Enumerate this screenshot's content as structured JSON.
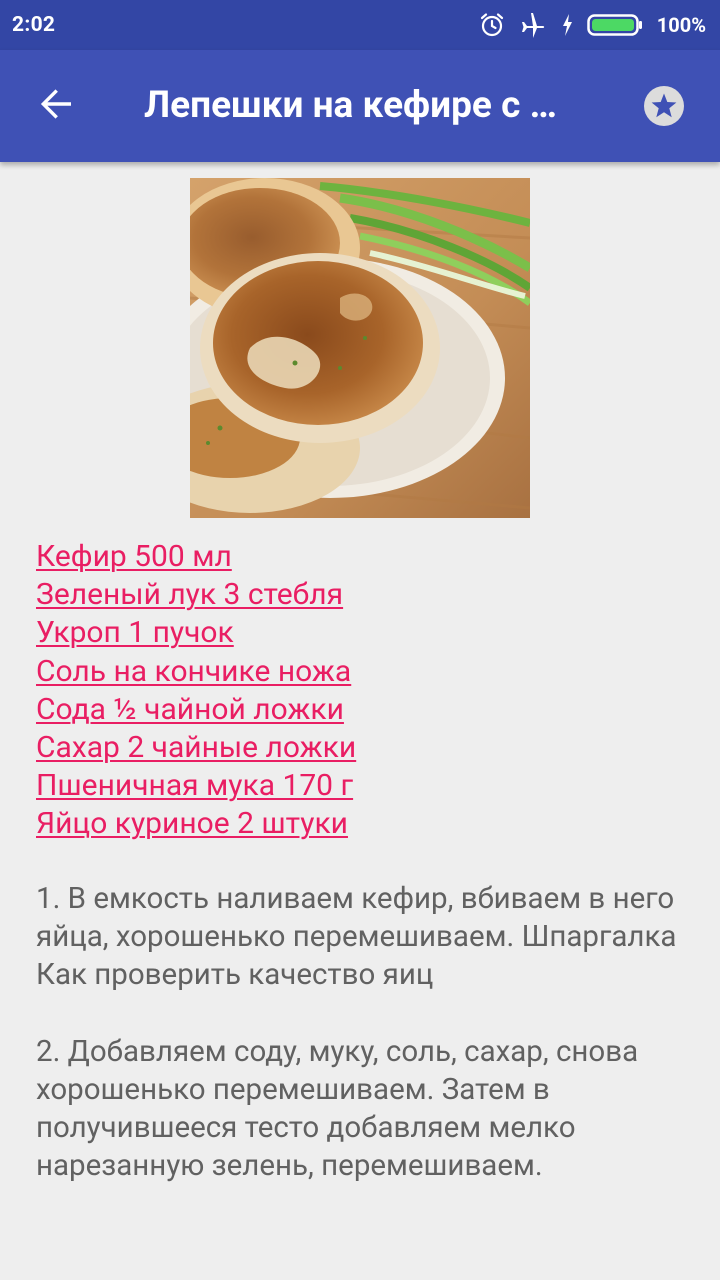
{
  "status_bar": {
    "time": "2:02",
    "icons": [
      "alarm-icon",
      "airplane-mode-icon",
      "charging-icon",
      "battery-icon"
    ],
    "battery": "100%"
  },
  "app_bar": {
    "title": "Лепешки на кефире с …",
    "back_icon": "arrow-back-icon",
    "favorite_icon": "star-icon",
    "color": "#3f51b5",
    "status_color": "#3346a5"
  },
  "recipe": {
    "ingredients": [
      "Кефир 500 мл",
      "Зеленый лук 3 стебля",
      "Укроп 1 пучок",
      "Соль на кончике ножа",
      "Сода ½ чайной ложки",
      "Сахар 2 чайные ложки",
      "Пшеничная мука 170 г",
      "Яйцо куриное 2 штуки"
    ],
    "steps": [
      "1. В емкость наливаем кефир, вбиваем в него яйца, хорошенько перемешиваем. Шпаргалка Как проверить качество яиц",
      "2. Добавляем соду, муку, соль, сахар, снова хорошенько перемешиваем. Затем в получившееся тесто добавляем мелко нарезанную зелень, перемешиваем."
    ],
    "link_color": "#e91e63",
    "text_color": "#616161"
  }
}
